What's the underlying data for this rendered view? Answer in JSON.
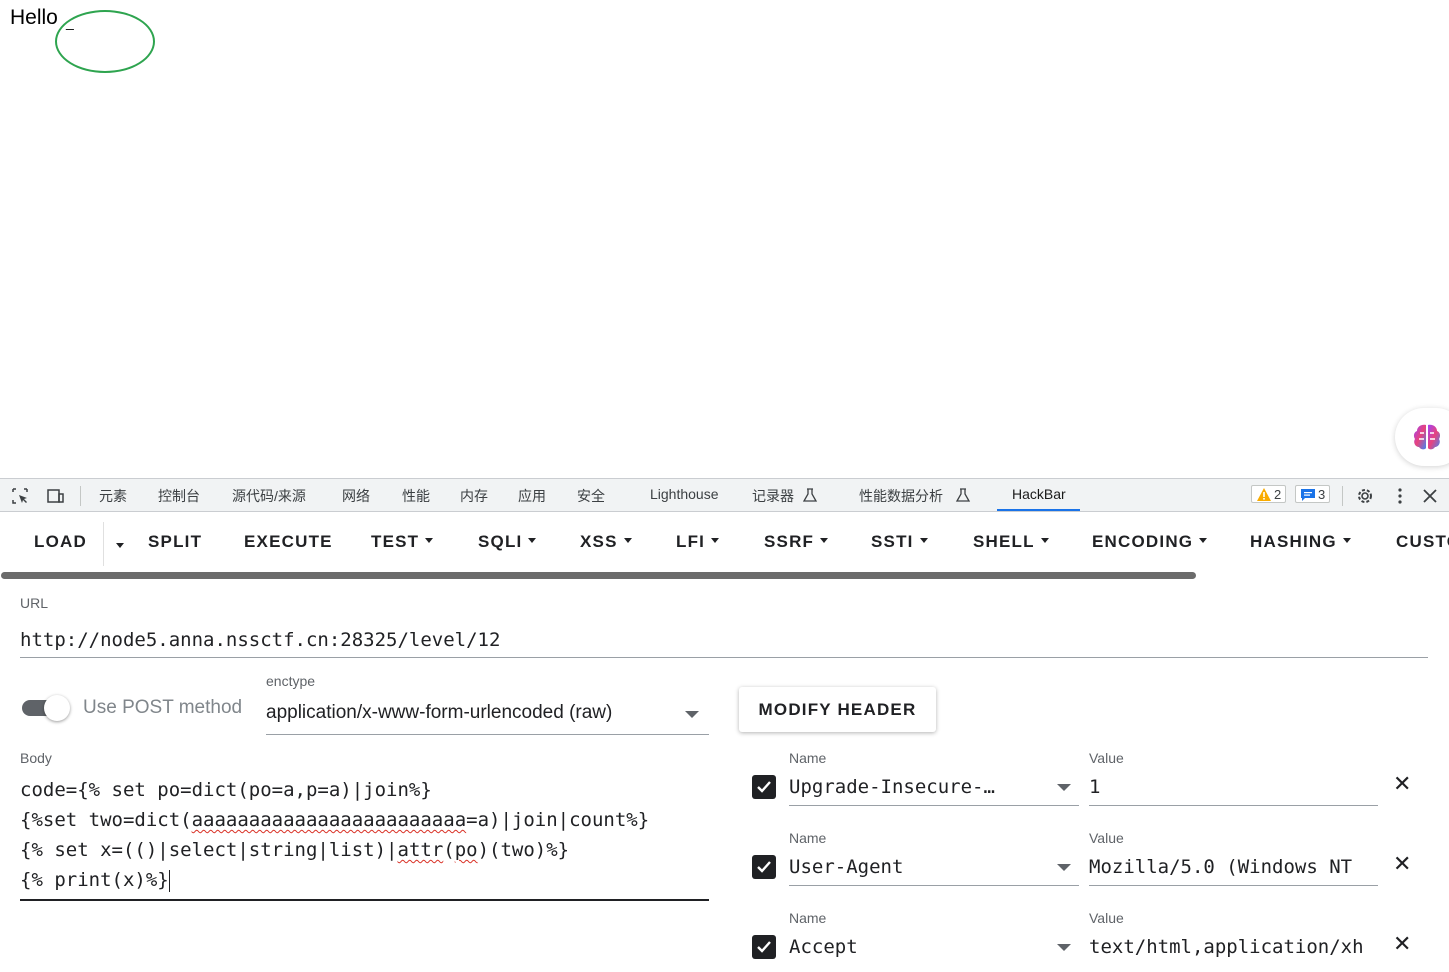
{
  "page": {
    "hello_text": "Hello",
    "cursor_text": "_"
  },
  "devtools": {
    "tabs": [
      {
        "label": "元素"
      },
      {
        "label": "控制台"
      },
      {
        "label": "源代码/来源"
      },
      {
        "label": "网络"
      },
      {
        "label": "性能"
      },
      {
        "label": "内存"
      },
      {
        "label": "应用"
      },
      {
        "label": "安全"
      },
      {
        "label": "Lighthouse"
      },
      {
        "label": "记录器"
      },
      {
        "label": "性能数据分析"
      },
      {
        "label": "HackBar",
        "active": true
      }
    ],
    "warnings_count": "2",
    "messages_count": "3",
    "colors": {
      "active_tab": "#1a73e8",
      "warning": "#f9ab00",
      "message": "#1a73e8"
    }
  },
  "hackbar": {
    "toolbar": {
      "load": "LOAD",
      "split": "SPLIT",
      "execute": "EXECUTE",
      "test": "TEST",
      "sqli": "SQLI",
      "xss": "XSS",
      "lfi": "LFI",
      "ssrf": "SSRF",
      "ssti": "SSTI",
      "shell": "SHELL",
      "encoding": "ENCODING",
      "hashing": "HASHING",
      "custom": "CUSTOM"
    },
    "url": {
      "label": "URL",
      "value": "http://node5.anna.nssctf.cn:28325/level/12"
    },
    "post": {
      "label": "Use POST method",
      "enabled": true
    },
    "enctype": {
      "label": "enctype",
      "value": "application/x-www-form-urlencoded (raw)"
    },
    "body": {
      "label": "Body",
      "line1": "code={% set po=dict(po=a,p=a)|join%}",
      "line2_pre": "{%set two=dict(",
      "line2_squiggle": "aaaaaaaaaaaaaaaaaaaaaaaa",
      "line2_post": "=a)|join|count%}",
      "line3_pre": "{% set x=(()|select|string|list)|",
      "line3_sq1": "attr",
      "line3_mid": "(",
      "line3_sq2": "po",
      "line3_post": ")(two)%}",
      "line4": "{% print(x)%}"
    },
    "modify_header_label": "MODIFY HEADER",
    "headers": [
      {
        "name_label": "Name",
        "name": "Upgrade-Insecure-…",
        "value_label": "Value",
        "value": "1",
        "checked": true
      },
      {
        "name_label": "Name",
        "name": "User-Agent",
        "value_label": "Value",
        "value": "Mozilla/5.0 (Windows NT",
        "checked": true
      },
      {
        "name_label": "Name",
        "name": "Accept",
        "value_label": "Value",
        "value": "text/html,application/xh",
        "checked": true
      }
    ]
  }
}
